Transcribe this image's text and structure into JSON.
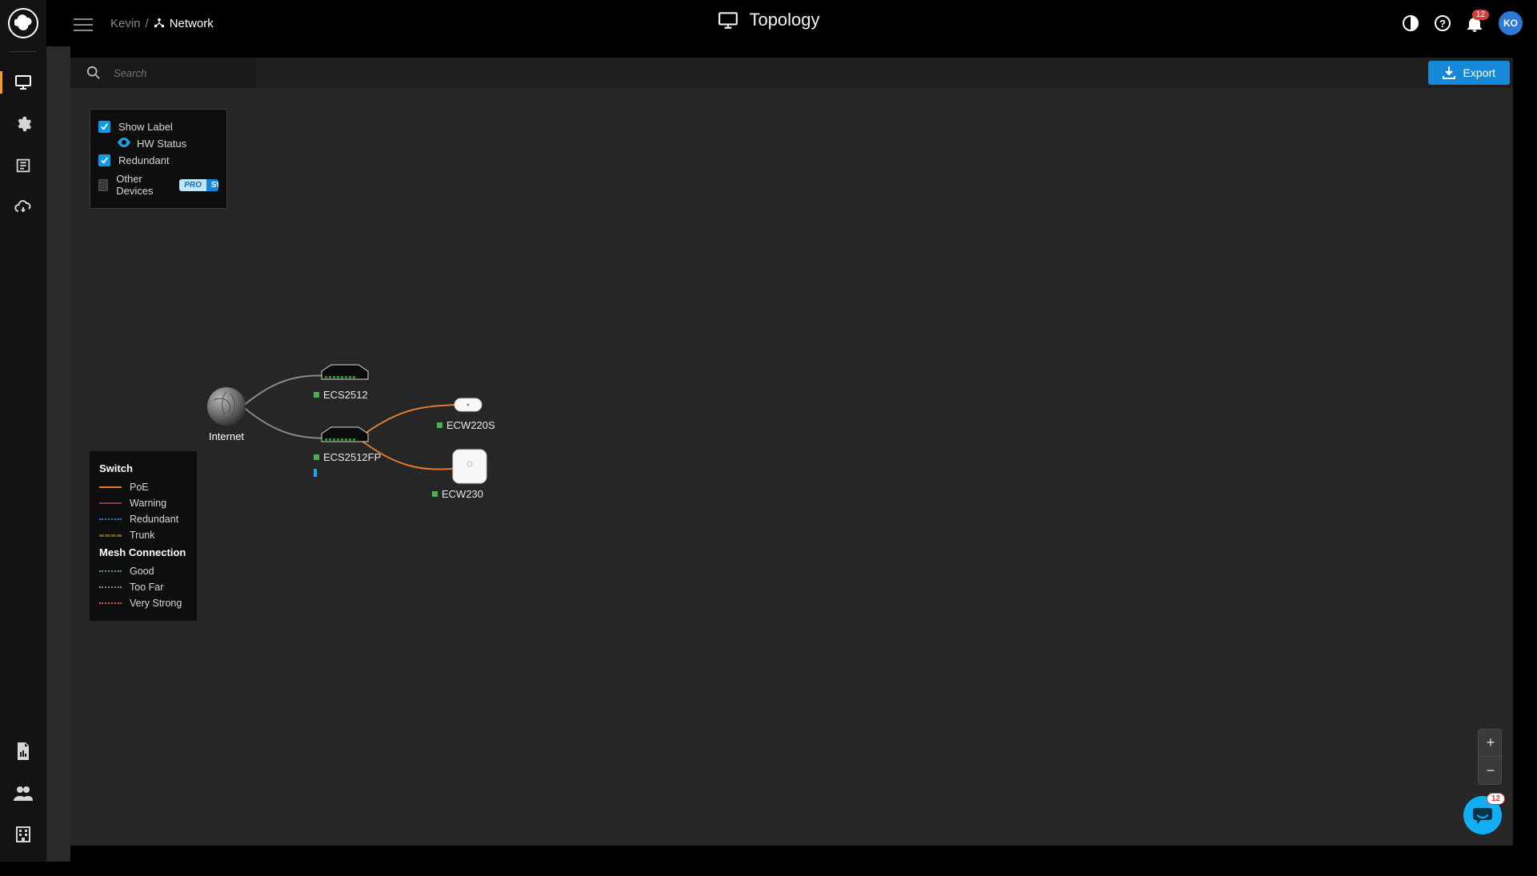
{
  "header": {
    "user": "Kevin",
    "sep": "/",
    "network_label": "Network",
    "title": "Topology",
    "notification_count": "12",
    "avatar_initials": "KO"
  },
  "toolbar": {
    "search_placeholder": "Search",
    "export_label": "Export"
  },
  "options": {
    "show_label": "Show Label",
    "hw_status": "HW Status",
    "redundant": "Redundant",
    "other_devices": "Other Devices",
    "pro_badge": "PRO",
    "sw_badge": "SW"
  },
  "legend": {
    "switch_title": "Switch",
    "mesh_title": "Mesh Connection",
    "switch_items": [
      {
        "label": "PoE",
        "color": "#e37a2e",
        "style": "solid"
      },
      {
        "label": "Warning",
        "color": "#8a3a4a",
        "style": "solid"
      },
      {
        "label": "Redundant",
        "color": "#1788d8",
        "style": "dotted"
      },
      {
        "label": "Trunk",
        "color": "#6b5b2c",
        "style": "dashed"
      }
    ],
    "mesh_items": [
      {
        "label": "Good",
        "color": "#4caf50",
        "style": "dotted"
      },
      {
        "label": "Too Far",
        "color": "#8a8a8a",
        "style": "dotted"
      },
      {
        "label": "Very Strong",
        "color": "#e05a2a",
        "style": "dotted"
      }
    ]
  },
  "topology": {
    "internet_label": "Internet",
    "nodes": [
      {
        "id": "sw1",
        "label": "ECS2512"
      },
      {
        "id": "sw2",
        "label": "ECS2512FP"
      },
      {
        "id": "ap1",
        "label": "ECW220S"
      },
      {
        "id": "ap2",
        "label": "ECW230"
      }
    ]
  },
  "chat": {
    "badge": "12"
  }
}
